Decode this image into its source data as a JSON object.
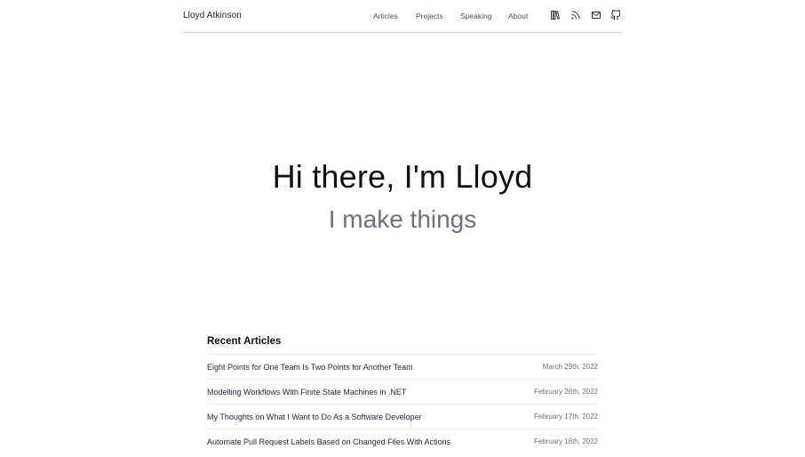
{
  "header": {
    "brand": "Lloyd Atkinson",
    "nav": [
      {
        "label": "Articles"
      },
      {
        "label": "Projects"
      },
      {
        "label": "Speaking"
      },
      {
        "label": "About"
      }
    ],
    "icons": [
      "books-icon",
      "rss-icon",
      "mail-icon",
      "github-icon"
    ]
  },
  "hero": {
    "title": "Hi there, I'm Lloyd",
    "subtitle": "I make things"
  },
  "recent": {
    "heading": "Recent Articles",
    "articles": [
      {
        "title": "Eight Points for One Team Is Two Points for Another Team",
        "date": "March 29th, 2022"
      },
      {
        "title": "Modelling Workflows With Finite State Machines in .NET",
        "date": "February 26th, 2022"
      },
      {
        "title": "My Thoughts on What I Want to Do As a Software Developer",
        "date": "February 17th, 2022"
      },
      {
        "title": "Automate Pull Request Labels Based on Changed Files With Actions",
        "date": "February 16th, 2022"
      }
    ]
  },
  "colors": {
    "divider": "#f3c4c8",
    "muted": "#6b7280",
    "text": "#111111"
  }
}
